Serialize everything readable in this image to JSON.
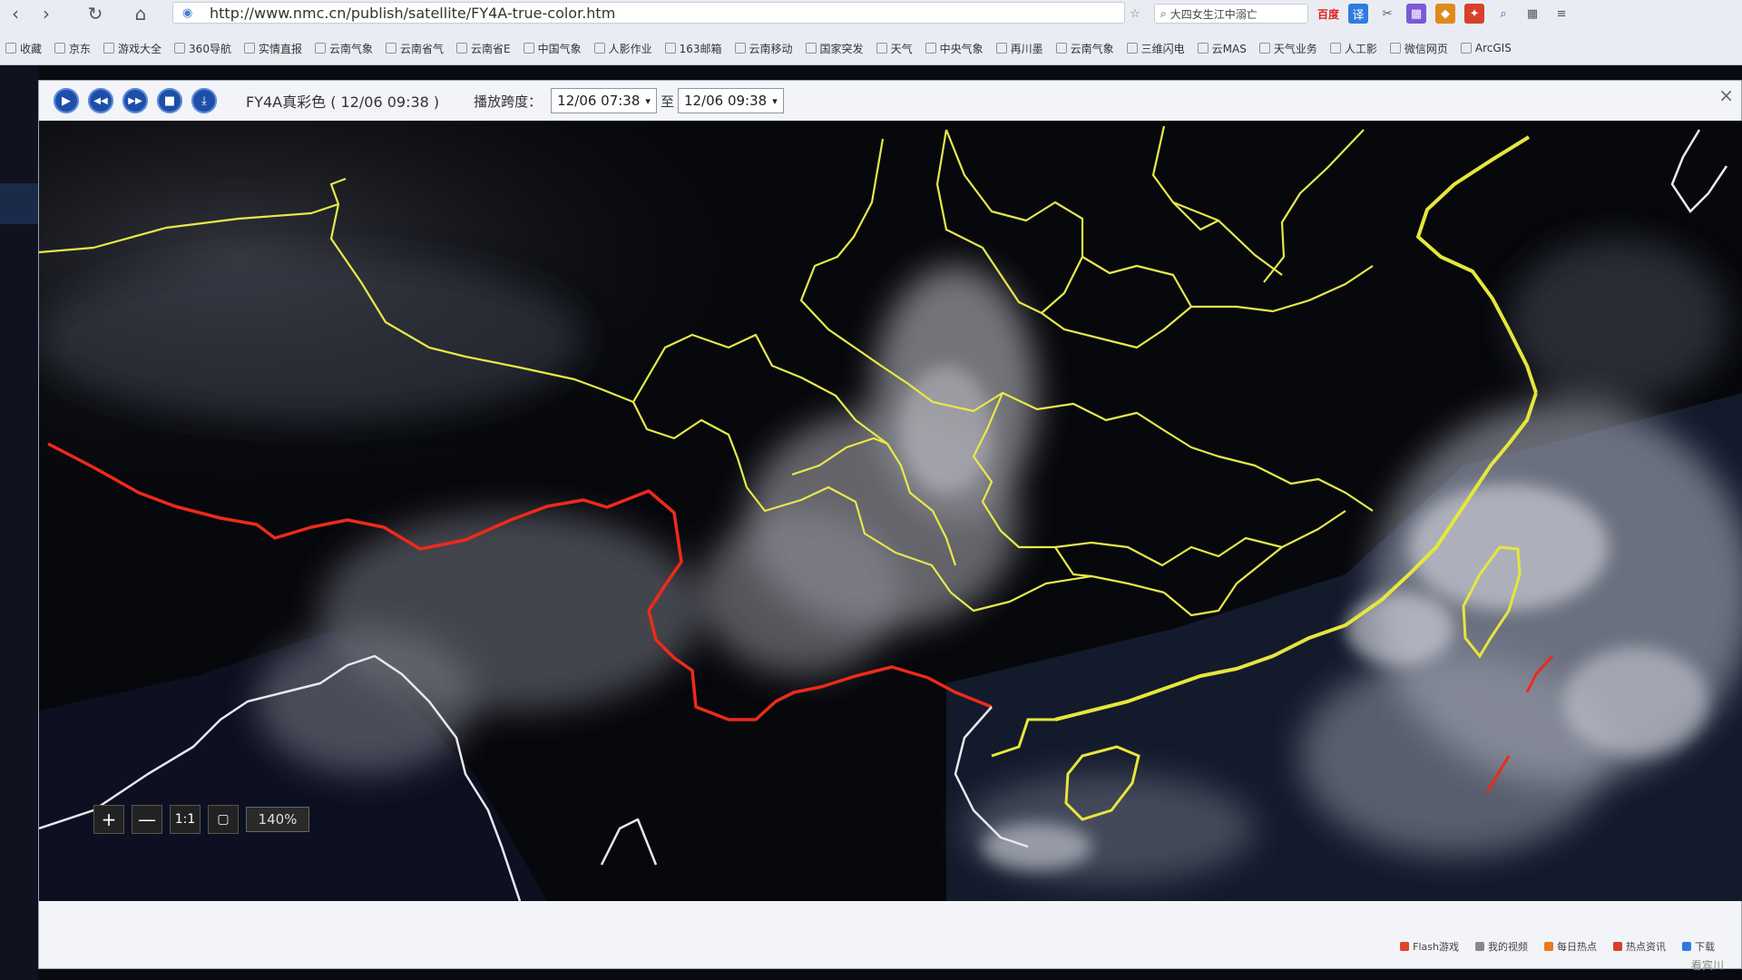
{
  "browser": {
    "url": "http://www.nmc.cn/publish/satellite/FY4A-true-color.htm",
    "search_text": "大四女生江中溺亡",
    "search_brand": "百度",
    "bookmarks": [
      "收藏",
      "京东",
      "游戏大全",
      "360导航",
      "实情直报",
      "云南气象",
      "云南省气",
      "云南省E",
      "中国气象",
      "人影作业",
      "163邮箱",
      "云南移动",
      "国家突发",
      "天气",
      "中央气象",
      "再川墨",
      "云南气象",
      "三维闪电",
      "云MAS",
      "天气业务",
      "人工影",
      "微信网页",
      "ArcGIS"
    ]
  },
  "viewer": {
    "frame_title": "FY4A真彩色 ( 12/06 09:38 )",
    "range_label": "播放跨度：",
    "range_from": "12/06 07:38",
    "range_to_label": "至",
    "range_to": "12/06 09:38",
    "close_label": "×",
    "controls": {
      "play": "▶",
      "prev": "◀◀",
      "next": "▶▶",
      "stop": "■",
      "save": "⤓"
    }
  },
  "zoom": {
    "plus": "+",
    "minus": "—",
    "reset": "1:1",
    "level": "140%"
  },
  "status_bar": [
    "Flash游戏",
    "我的视频",
    "每日热点",
    "热点资讯",
    "下载"
  ],
  "watermark": "看宾川",
  "colors": {
    "province_border": "#e8e84a",
    "national_border_sw": "#ee2a1a",
    "coastline_sw": "#e8e8ee",
    "control_blue": "#1d4fa8"
  }
}
